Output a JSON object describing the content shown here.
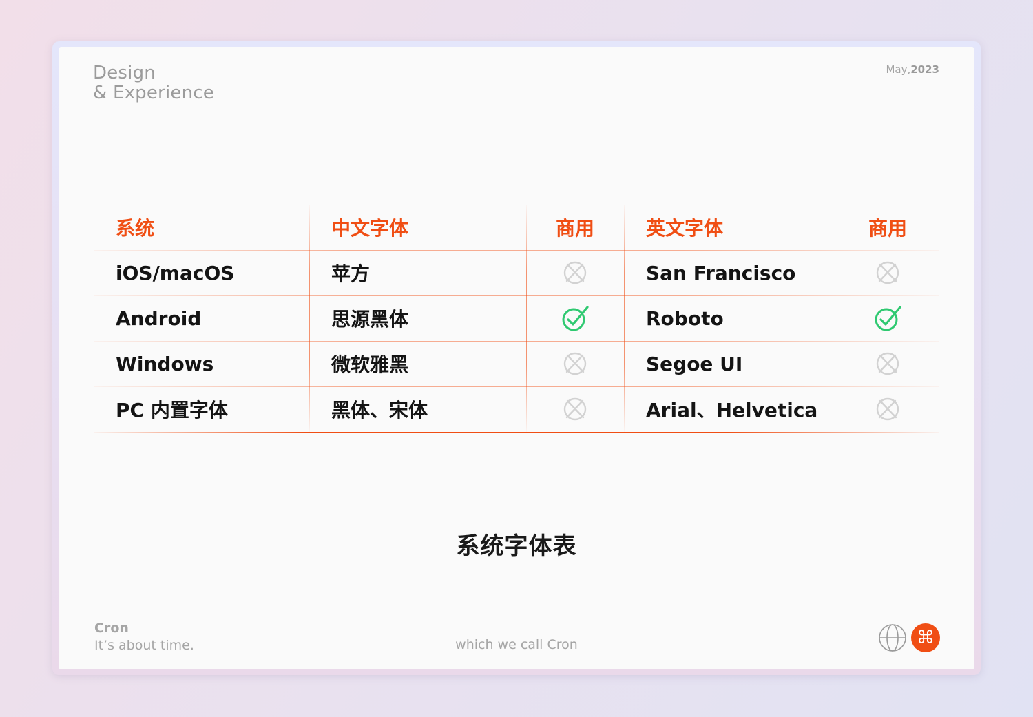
{
  "header": {
    "brand_line1": "Design",
    "brand_line2": "& Experience",
    "date_month": "May,",
    "date_year": "2023"
  },
  "table": {
    "headers": [
      "系统",
      "中文字体",
      "商用",
      "英文字体",
      "商用"
    ],
    "rows": [
      {
        "system": "iOS/macOS",
        "cn_font": "苹方",
        "cn_commercial": "no",
        "en_font": "San Francisco",
        "en_commercial": "no"
      },
      {
        "system": "Android",
        "cn_font": "思源黑体",
        "cn_commercial": "yes",
        "en_font": "Roboto",
        "en_commercial": "yes"
      },
      {
        "system": "Windows",
        "cn_font": "微软雅黑",
        "cn_commercial": "no",
        "en_font": "Segoe UI",
        "en_commercial": "no"
      },
      {
        "system": "PC 内置字体",
        "cn_font": "黑体、宋体",
        "cn_commercial": "no",
        "en_font": "Arial、Helvetica",
        "en_commercial": "no"
      }
    ],
    "icons": {
      "yes": "check-circle-icon",
      "no": "cross-circle-icon"
    }
  },
  "caption": "系统字体表",
  "footer": {
    "brand_name": "Cron",
    "tagline": "It’s about time.",
    "center_text": "which we call Cron",
    "globe_icon": "globe-icon",
    "command_icon": "command-icon",
    "command_glyph": "⌘"
  },
  "colors": {
    "accent": "#f04e14",
    "check": "#2fc971",
    "cross": "#d2d2d2",
    "text": "#141414",
    "muted": "#a5a5a5"
  }
}
